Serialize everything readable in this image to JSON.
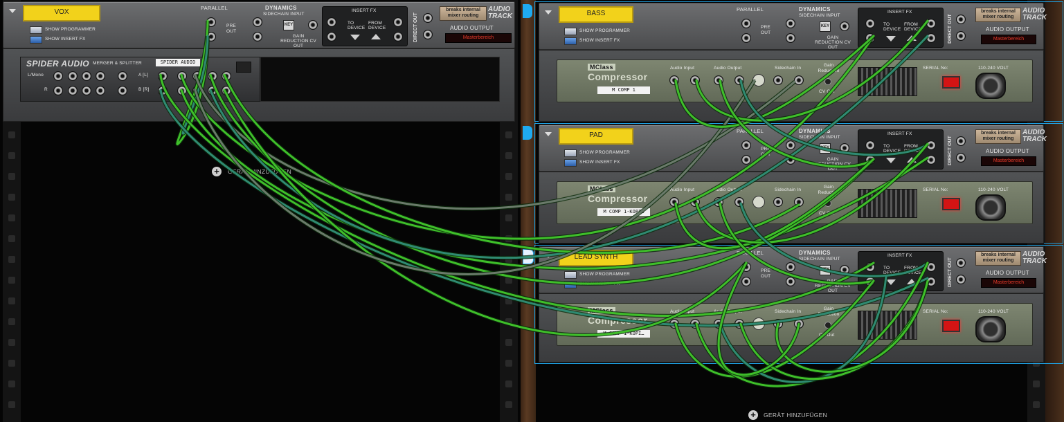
{
  "colors": {
    "cable_green": "#3fbf2a",
    "cable_teal": "#2f8a72",
    "cable_gray": "#6a7a6a",
    "label_yellow": "#f2d21b",
    "selection_blue": "#1faaf0"
  },
  "vox": {
    "name": "VOX",
    "show_programmer": "SHOW PROGRAMMER",
    "show_insert_fx": "SHOW INSERT FX",
    "parallel": "PARALLEL",
    "pre_out": "PRE OUT",
    "dynamics": "DYNAMICS",
    "sidechain_input": "SIDECHAIN INPUT",
    "key": "KEY",
    "gain_reduction": "GAIN REDUCTION CV OUT",
    "insert_fx": "INSERT FX",
    "to_device": "TO DEVICE",
    "from_device": "FROM DEVICE",
    "direct_out": "DIRECT OUT",
    "badge": "breaks internal mixer routing",
    "audio_track": "AUDIO TRACK",
    "audio_output": "AUDIO OUTPUT",
    "output_value": "Masterbereich"
  },
  "spider": {
    "brand": "SPIDER AUDIO",
    "subtitle": "MERGER & SPLITTER",
    "tape": "SPIDER AUDIO",
    "lmono": "L/Mono",
    "r": "R",
    "a_l": "A [L]",
    "b_r": "B [R]"
  },
  "add_device_left": "GERÄT HINZUFÜGEN",
  "add_device_right": "GERÄT HINZUFÜGEN",
  "tracks": [
    {
      "name": "BASS",
      "tape": "M COMP 1"
    },
    {
      "name": "PAD",
      "tape": "M COMP 1-KOPIE"
    },
    {
      "name": "LEAD SYNTH",
      "tape": "M COMP 1-KOPI…"
    }
  ],
  "compressor": {
    "brand": "MClass",
    "title": "Compressor",
    "audio_input": "Audio Input",
    "audio_output": "Audio Output",
    "sidechain_in": "Sidechain In",
    "gain_reduction": "Gain Reduction",
    "cv_out": "CV Out",
    "serial": "SERIAL No:",
    "voltage": "110-240 VOLT"
  }
}
